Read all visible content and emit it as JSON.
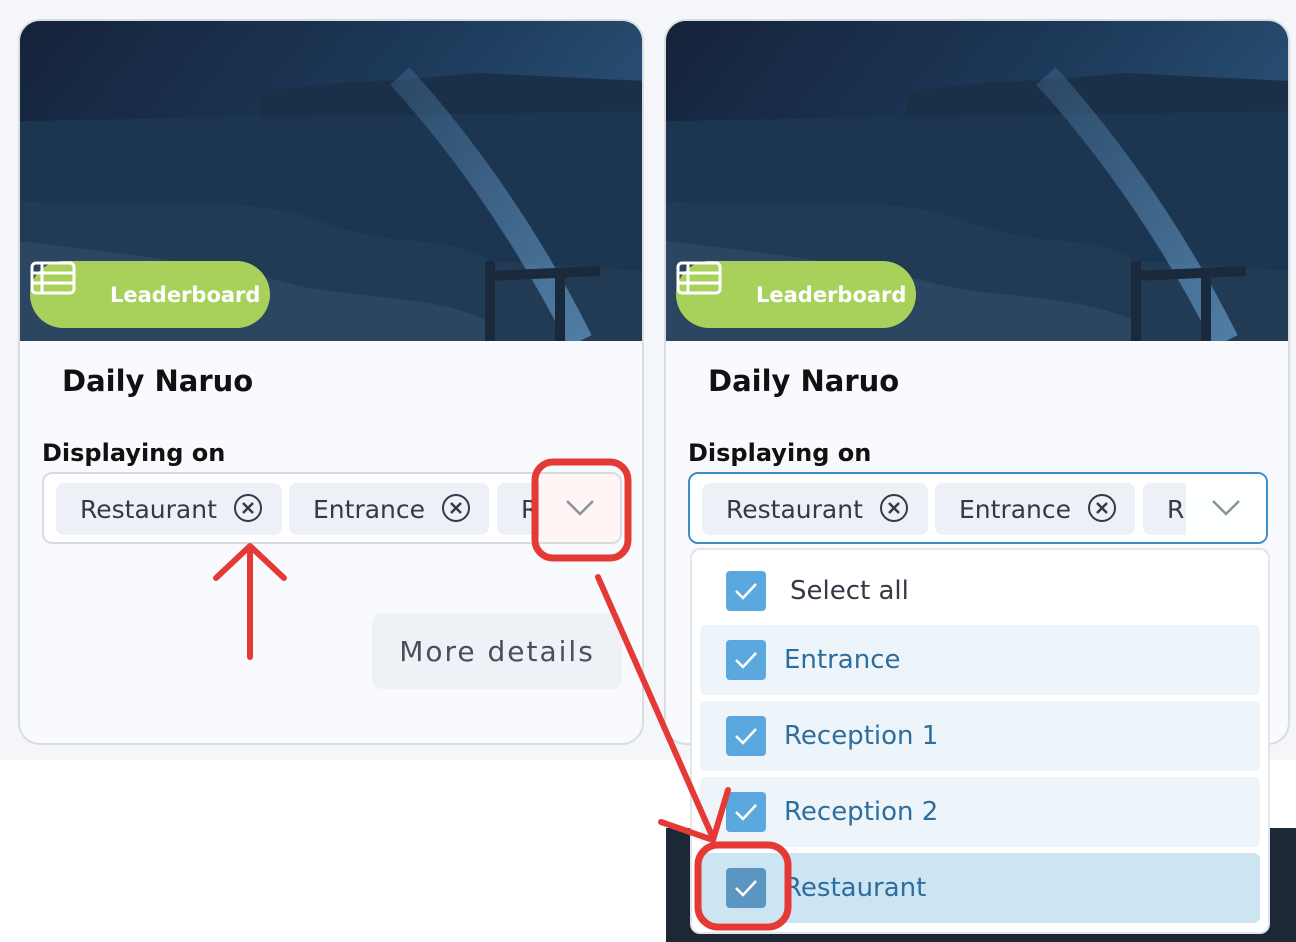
{
  "colors": {
    "badge_green": "#a8d15c",
    "checkbox_blue": "#5aa8de",
    "annotation_red": "#e53935",
    "focus_blue": "#3d8fc9"
  },
  "left_card": {
    "badge": {
      "icon": "table-list-icon",
      "label": "Leaderboard"
    },
    "title": "Daily Naruo",
    "displaying_label": "Displaying on",
    "chips": [
      {
        "label": "Restaurant"
      },
      {
        "label": "Entrance"
      },
      {
        "label": "R"
      }
    ],
    "more_details": "More details"
  },
  "right_card": {
    "badge": {
      "icon": "table-list-icon",
      "label": "Leaderboard"
    },
    "title": "Daily Naruo",
    "displaying_label": "Displaying on",
    "chips": [
      {
        "label": "Restaurant"
      },
      {
        "label": "Entrance"
      },
      {
        "label": "R"
      }
    ]
  },
  "dropdown": {
    "options": [
      {
        "label": "Select all",
        "checked": true
      },
      {
        "label": "Entrance",
        "checked": true
      },
      {
        "label": "Reception 1",
        "checked": true
      },
      {
        "label": "Reception 2",
        "checked": true
      },
      {
        "label": "Restaurant",
        "checked": true
      }
    ]
  }
}
